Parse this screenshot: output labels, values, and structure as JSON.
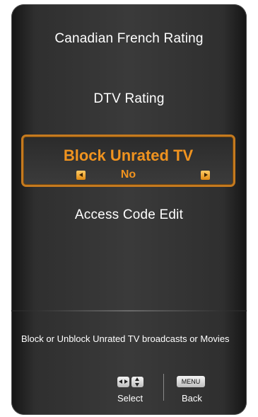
{
  "menu": {
    "items": [
      {
        "label": "Canadian French Rating"
      },
      {
        "label": "DTV Rating"
      },
      {
        "label": "Block Unrated TV",
        "value": "No",
        "selected": true
      },
      {
        "label": "Access Code Edit"
      }
    ]
  },
  "footer": {
    "help_text": "Block or Unblock Unrated TV broadcasts or Movies",
    "select_label": "Select",
    "back_label": "Back",
    "menu_key_label": "MENU"
  },
  "colors": {
    "selection_border": "#c57a1f",
    "selection_text": "#f0931f",
    "background": "#333333"
  },
  "icons": [
    "left-arrow-icon",
    "right-arrow-icon",
    "left-right-key-icon",
    "up-down-key-icon"
  ]
}
